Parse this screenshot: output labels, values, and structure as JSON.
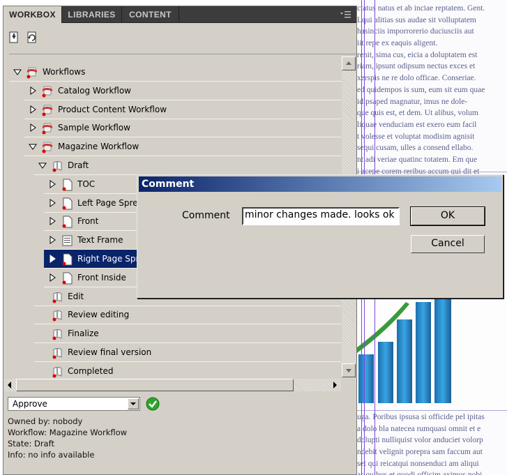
{
  "tabs": [
    {
      "label": "WORKBOX",
      "active": true
    },
    {
      "label": "LIBRARIES",
      "active": false
    },
    {
      "label": "CONTENT",
      "active": false
    }
  ],
  "tree": {
    "rows": [
      {
        "label": "Workflows",
        "expanded": true,
        "icon": "workflows-folder-icon"
      },
      {
        "label": "Catalog Workflow",
        "expanded": false,
        "icon": "workflow-icon"
      },
      {
        "label": "Product Content Workflow",
        "expanded": false,
        "icon": "workflow-icon"
      },
      {
        "label": "Sample Workflow",
        "expanded": false,
        "icon": "workflow-icon"
      },
      {
        "label": "Magazine Workflow",
        "expanded": true,
        "icon": "workflow-icon"
      },
      {
        "label": "Draft",
        "expanded": true,
        "icon": "state-icon"
      },
      {
        "label": "TOC",
        "expanded": false,
        "icon": "page-icon"
      },
      {
        "label": "Left Page Spread",
        "expanded": false,
        "icon": "page-icon"
      },
      {
        "label": "Front",
        "expanded": false,
        "icon": "page-icon"
      },
      {
        "label": "Text Frame",
        "expanded": false,
        "icon": "text-frame-icon"
      },
      {
        "label": "Right Page Spread",
        "expanded": false,
        "icon": "page-icon",
        "selected": true
      },
      {
        "label": "Front Inside",
        "expanded": false,
        "icon": "page-icon"
      },
      {
        "label": "Edit",
        "icon": "state-icon"
      },
      {
        "label": "Review editing",
        "icon": "state-icon"
      },
      {
        "label": "Finalize",
        "icon": "state-icon"
      },
      {
        "label": "Review final version",
        "icon": "state-icon"
      },
      {
        "label": "Completed",
        "icon": "state-icon"
      }
    ]
  },
  "action": {
    "selected": "Approve"
  },
  "info": {
    "owned_by": "Owned by: nobody",
    "workflow": "Workflow: Magazine Workflow",
    "state": "State: Draft",
    "info": "Info: no info available"
  },
  "dialog": {
    "title": "Comment",
    "label": "Comment",
    "value": "minor changes made. looks ok",
    "ok_label": "OK",
    "cancel_label": "Cancel"
  },
  "document": {
    "top_lines": [
      "ctatus natus et ab inciae reptatem. Gent.",
      "Lqui alitias sus audae sit volluptatem",
      "hasinciis imporrorerio duciusciis aut",
      "iit repe ex eaquis aligent.",
      "renit, sima cus, eicia a doluptatem est",
      "riam, ipsunt odipsum nectus exces et",
      "xerspis ne re dolo officae. Conseriae.",
      "ed quidempos is sum, eum sit eum quae",
      "idipsaped magnatur, imus ne dole-",
      "que quis est, et dem. Ut alibus, volum",
      "liquae venduciam est exero eum facil",
      "t volesse et voluptat modisim agnisit",
      "sequi cusam, ulles a consend ellabo.",
      "nt adi veriae quatinc totatem. Em que",
      "i acepe corem reribus accum qui dit et"
    ],
    "bottom_lines": [
      "uga. Poribus ipsusa si officide pel ipitas",
      "a dolo bla natecea rumquasi omnit et e",
      "dolupti nulliquist volor anduciet volorp",
      "ndebit velignit porepra sam faccum aut",
      "set qui reicatqui nonsenduci am aliqui",
      "as quibus et quodi officim aximus nobi"
    ]
  },
  "colors": {
    "selection": "#0a246a",
    "title_gradient_start": "#0a246a",
    "title_gradient_end": "#a6caf0",
    "marker_red": "#e00000",
    "go_green": "#2ea52e"
  }
}
